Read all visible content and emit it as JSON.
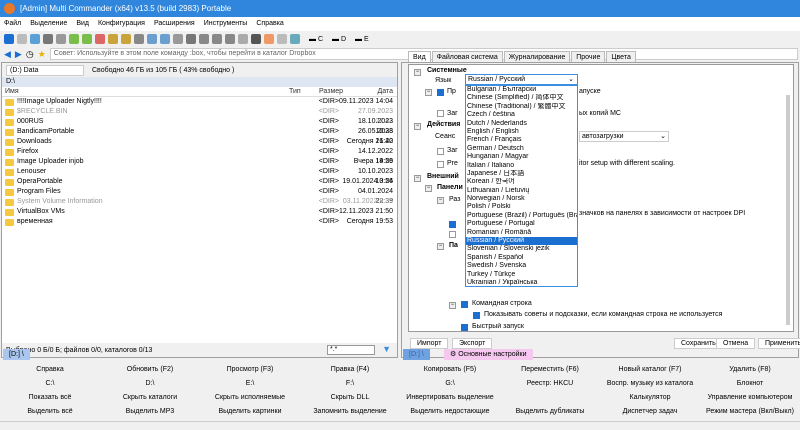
{
  "title": "[Admin] Multi Commander (x64)  v13.5 (build 2983) Portable",
  "menu": [
    "Файл",
    "Выделение",
    "Вид",
    "Конфигурация",
    "Расширения",
    "Инструменты",
    "Справка"
  ],
  "drives_toolbar": [
    "C",
    "D",
    "E"
  ],
  "command_placeholder": "Совет: Используйте в этом поле команду :box, чтобы перейти в каталог Dropbox",
  "left": {
    "drive": "(D:) Data",
    "free": "Свободно 46 ГБ из 105 ГБ ( 43% свободно )",
    "path": "D:\\",
    "columns": [
      "Имя",
      "Тип",
      "Размер",
      "Дата"
    ],
    "rows": [
      {
        "name": "!!!!Image Uploader Nigtly!!!!",
        "size": "<DIR>",
        "date": "09.11.2023 14:04"
      },
      {
        "name": "$RECYCLE.BIN",
        "size": "<DIR>",
        "date": "27.09.2023 22:42",
        "gray": true
      },
      {
        "name": "000RUS",
        "size": "<DIR>",
        "date": "18.10.2023 10:38"
      },
      {
        "name": "BandicamPortable",
        "size": "<DIR>",
        "date": "26.05.2023 16:42"
      },
      {
        "name": "Downloads",
        "size": "<DIR>",
        "date": "Сегодня 21:20"
      },
      {
        "name": "Firefox",
        "size": "<DIR>",
        "date": "14.12.2022 19:26"
      },
      {
        "name": "Image Uploader injob",
        "size": "<DIR>",
        "date": "Вчера 14:59"
      },
      {
        "name": "Lenouser",
        "size": "<DIR>",
        "date": "10.10.2023 13:54"
      },
      {
        "name": "OperaPortable",
        "size": "<DIR>",
        "date": "19.01.2024 0:26"
      },
      {
        "name": "Program Files",
        "size": "<DIR>",
        "date": "04.01.2024 22:39"
      },
      {
        "name": "System Volume Information",
        "size": "<DIR>",
        "date": "03.11.2022 9:35",
        "gray": true
      },
      {
        "name": "VirtualBox VMs",
        "size": "<DIR>",
        "date": "12.11.2023 21:50"
      },
      {
        "name": "временная",
        "size": "<DIR>",
        "date": "Сегодня 19:53"
      }
    ],
    "status": "Выбрано 0 Б/0 Б; файлов 0/0, каталогов 0/13",
    "filter": "*.*",
    "tab": "[D:] \\"
  },
  "right": {
    "tabs": [
      "Вид",
      "Файловая система",
      "Журналирование",
      "Прочие",
      "Цвета"
    ],
    "sec_system": "Системные",
    "lang_label": "Язык",
    "lang_value": "Russian / Русский",
    "t1": "Пр",
    "t1b": "апуске",
    "t2": "Заг",
    "t2b": "ых копий MC",
    "sec_actions": "Действия",
    "t3": "Сеанс",
    "t3b": "автозагрузки",
    "t4": "Заг",
    "t5": "Pre",
    "t5b": "itor setup with different scaling.",
    "sec_ext": "Внешний",
    "sec_panel": "Панели",
    "t6": "Раз",
    "t6b": "значков на панелях в зависимости от настроек DPI",
    "t7": "Па",
    "cmdline": "Командная строка",
    "hints": "Показывать советы и подсказки, если командная строка не используется",
    "quick": "Быстрый запуск",
    "languages": [
      "Bulgarian / Български",
      "Chinese (Simplified) / 简体中文",
      "Chinese (Traditional) / 繁體中文",
      "Czech / čeština",
      "Dutch / Nederlands",
      "English / English",
      "French / Français",
      "German / Deutsch",
      "Hungarian / Magyar",
      "Italian / Italiano",
      "Japanese / 日本語",
      "Korean / 한국어",
      "Lithuanian / Lietuvių",
      "Norwegian / Norsk",
      "Polish / Polski",
      "Portuguese (Brazil) / Português (Brasil)",
      "Portuguese / Portugal",
      "Romanian / Română",
      "Russian / Русский",
      "Slovenian / Slovenski jezik",
      "Spanish / Español",
      "Swedish / Svenska",
      "Turkey / Türkçe",
      "Ukrainian / Українська"
    ],
    "selected_index": 18,
    "buttons": {
      "import": "Импорт",
      "export": "Экспорт",
      "save": "Сохранить",
      "cancel": "Отмена",
      "apply": "Применить"
    },
    "tab_drive": "[D:] \\",
    "tab_settings": "Основные настройки"
  },
  "buttonbar": [
    "Справка",
    "Обновить (F2)",
    "Просмотр (F3)",
    "Правка (F4)",
    "Копировать (F5)",
    "Переместить (F6)",
    "Новый каталог (F7)",
    "Удалить (F8)",
    "C:\\",
    "D:\\",
    "E:\\",
    "F:\\",
    "G:\\",
    "Реестр: HKCU",
    "Воспр. музыку из каталога",
    "Блокнот",
    "Показать всё",
    "Скрыть каталоги",
    "Скрыть исполняемые",
    "Скрыть DLL",
    "Инвертировать выделение",
    "",
    "Калькулятор",
    "Управление компьютером",
    "Выделить всё",
    "Выделить MP3",
    "Выделить картинки",
    "Запомнить выделение",
    "Выделить недостающие",
    "Выделить дубликаты",
    "Диспетчер задач",
    "Режим мастера (Вкл/Выкл)"
  ]
}
